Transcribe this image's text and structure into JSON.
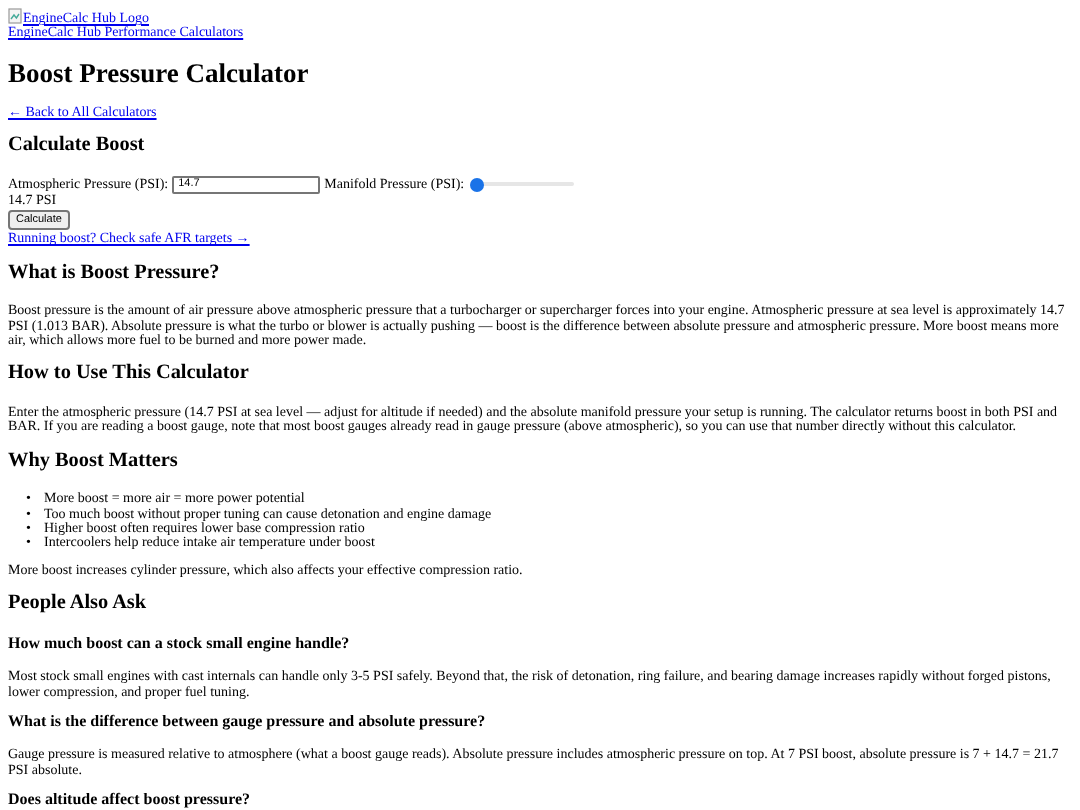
{
  "header": {
    "logo_alt": "EngineCalc Hub Logo",
    "site_link": "EngineCalc Hub Performance Calculators"
  },
  "title": "Boost Pressure Calculator",
  "back_link": "← Back to All Calculators",
  "calculator": {
    "heading": "Calculate Boost",
    "atmospheric_label": "Atmospheric Pressure (PSI):",
    "atmospheric_value": "14.7",
    "manifold_label": "Manifold Pressure (PSI):",
    "manifold_slider": {
      "level": 0
    },
    "result": "14.7 PSI",
    "button": "Calculate",
    "afr_link": "Running boost? Check safe AFR targets →"
  },
  "sections": [
    {
      "heading": "What is Boost Pressure?",
      "paragraphs": [
        "Boost pressure is the amount of air pressure above atmospheric pressure that a turbocharger or supercharger forces into your engine. Atmospheric pressure at sea level is approximately 14.7 PSI (1.013 BAR). Absolute pressure is what the turbo or blower is actually pushing — boost is the difference between absolute pressure and atmospheric pressure. More boost means more air, which allows more fuel to be burned and more power made."
      ]
    },
    {
      "heading": "How to Use This Calculator",
      "paragraphs": [
        "Enter the atmospheric pressure (14.7 PSI at sea level — adjust for altitude if needed) and the absolute manifold pressure your setup is running. The calculator returns boost in both PSI and BAR. If you are reading a boost gauge, note that most boost gauges already read in gauge pressure (above atmospheric), so you can use that number directly without this calculator."
      ]
    },
    {
      "heading": "Why Boost Matters",
      "bullet_marker": "•",
      "bullets": [
        "More boost = more air = more power potential",
        "Too much boost without proper tuning can cause detonation and engine damage",
        "Higher boost often requires lower base compression ratio",
        "Intercoolers help reduce intake air temperature under boost"
      ],
      "paragraphs": [
        "More boost increases cylinder pressure, which also affects your effective compression ratio."
      ]
    }
  ],
  "faq": {
    "heading": "People Also Ask",
    "items": [
      {
        "question": "How much boost can a stock small engine handle?",
        "answer": "Most stock small engines with cast internals can handle only 3-5 PSI safely. Beyond that, the risk of detonation, ring failure, and bearing damage increases rapidly without forged pistons, lower compression, and proper fuel tuning."
      },
      {
        "question": "What is the difference between gauge pressure and absolute pressure?",
        "answer": "Gauge pressure is measured relative to atmosphere (what a boost gauge reads). Absolute pressure includes atmospheric pressure on top. At 7 PSI boost, absolute pressure is 7 + 14.7 = 21.7 PSI absolute."
      },
      {
        "question": "Does altitude affect boost pressure?"
      }
    ]
  }
}
